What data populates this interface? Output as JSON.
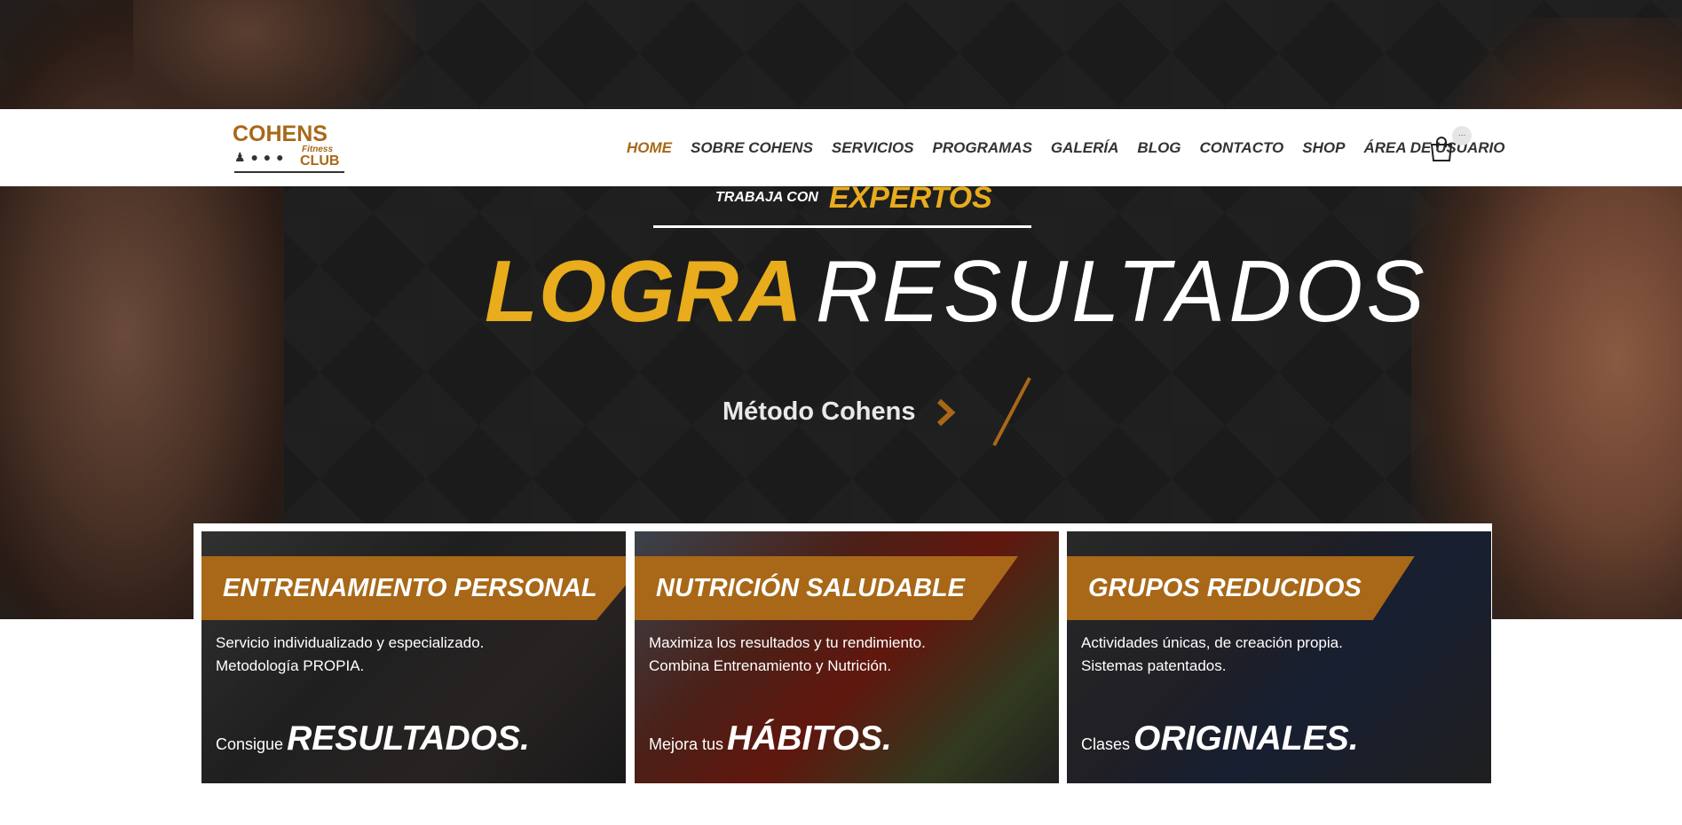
{
  "brand": {
    "logo_title": "COHENS",
    "logo_sub1": "Fitness",
    "logo_sub2": "CLUB"
  },
  "nav": {
    "items": [
      {
        "label": "HOME",
        "active": true
      },
      {
        "label": "SOBRE COHENS",
        "active": false
      },
      {
        "label": "SERVICIOS",
        "active": false
      },
      {
        "label": "PROGRAMAS",
        "active": false
      },
      {
        "label": "GALERÍA",
        "active": false
      },
      {
        "label": "BLOG",
        "active": false
      },
      {
        "label": "CONTACTO",
        "active": false
      },
      {
        "label": "SHOP",
        "active": false
      },
      {
        "label": "ÁREA DE USUARIO",
        "active": false
      }
    ],
    "cart_icon": "shopping-bag-icon",
    "cart_badge": "..."
  },
  "hero": {
    "kicker_small": "TRABAJA CON",
    "kicker_big": "EXPERTOS",
    "headline_bold": "LOGRA",
    "headline_light": "RESULTADOS",
    "cta_label": "Método Cohens",
    "cta_icon": "chevron-right-icon"
  },
  "cards": [
    {
      "title": "ENTRENAMIENTO PERSONAL",
      "desc_line1": "Servicio individualizado y especializado.",
      "desc_line2": "Metodología PROPIA.",
      "footer_prefix": "Consigue",
      "footer_emph": "RESULTADOS."
    },
    {
      "title": "NUTRICIÓN SALUDABLE",
      "desc_line1": "Maximiza los resultados y tu rendimiento.",
      "desc_line2": "Combina Entrenamiento y Nutrición.",
      "footer_prefix": "Mejora tus",
      "footer_emph": "HÁBITOS."
    },
    {
      "title": "GRUPOS REDUCIDOS",
      "desc_line1": "Actividades únicas, de creación propia.",
      "desc_line2": "Sistemas patentados.",
      "footer_prefix": "Clases",
      "footer_emph": "ORIGINALES."
    }
  ],
  "colors": {
    "accent": "#a86818",
    "gold": "#e8ac1c",
    "hero_bg": "#1b1b1b",
    "nav_text": "#333333"
  }
}
